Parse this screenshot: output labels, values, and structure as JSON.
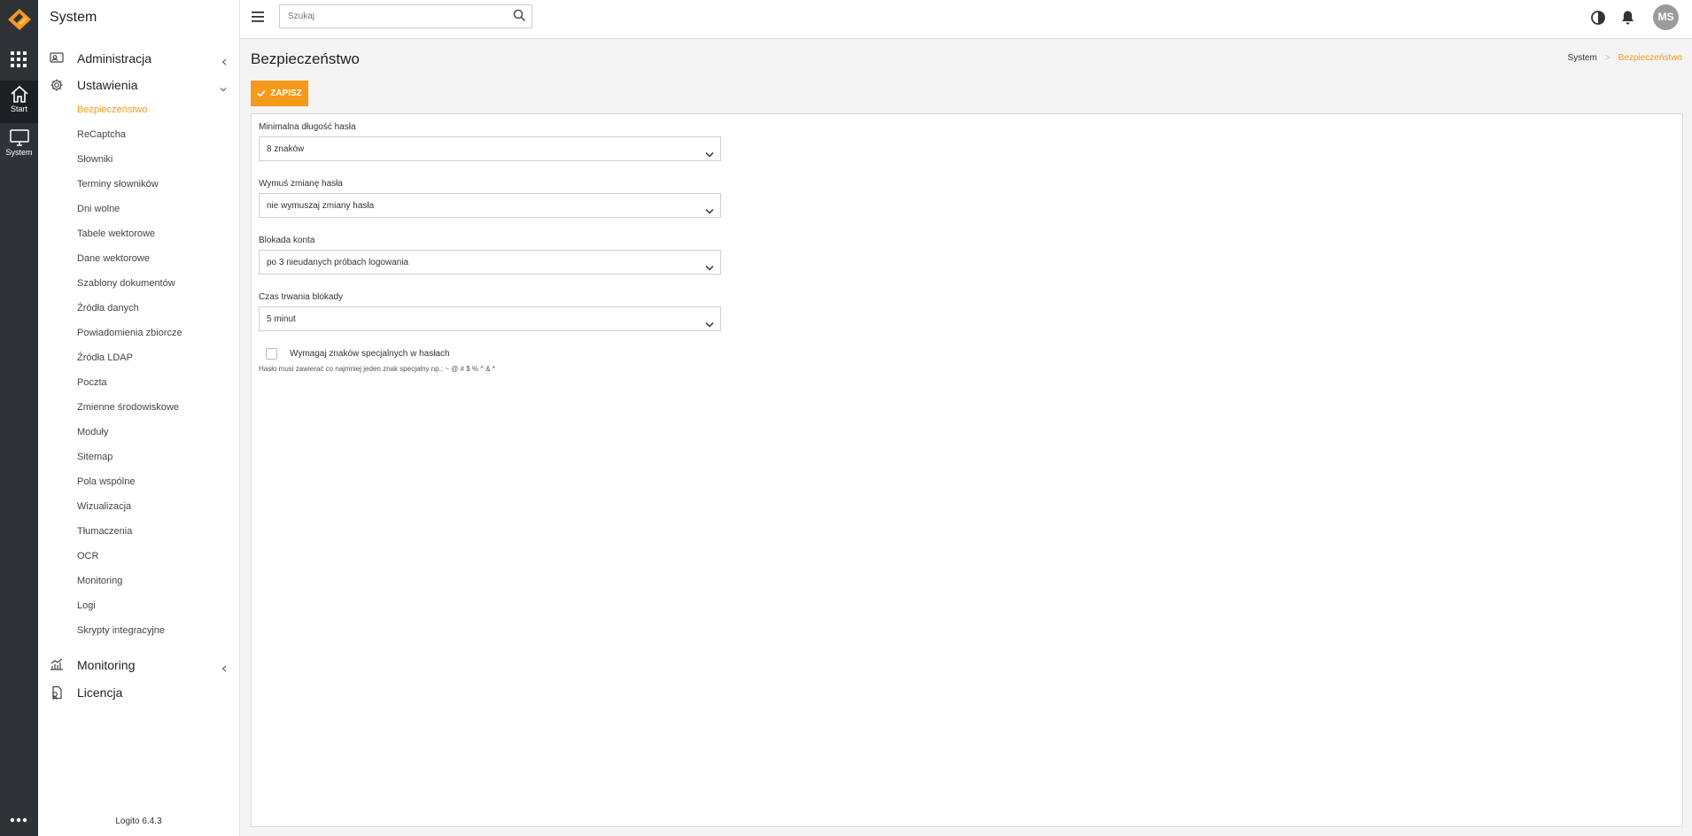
{
  "app": {
    "section_title": "System",
    "version": "Logito 6.4.3"
  },
  "rail": {
    "items": [
      {
        "label": "Start",
        "icon": "home-icon"
      },
      {
        "label": "System",
        "icon": "monitor-icon"
      }
    ]
  },
  "sidebar": {
    "sections": [
      {
        "label": "Administracja",
        "icon": "admin-id-card-icon",
        "expanded": false
      },
      {
        "label": "Ustawienia",
        "icon": "gear-icon",
        "expanded": true
      },
      {
        "label": "Monitoring",
        "icon": "chart-icon",
        "expanded": false
      },
      {
        "label": "Licencja",
        "icon": "license-icon",
        "expanded": false
      }
    ],
    "settings_items": [
      "Bezpieczeństwo",
      "ReCaptcha",
      "Słowniki",
      "Terminy słowników",
      "Dni wolne",
      "Tabele wektorowe",
      "Dane wektorowe",
      "Szablony dokumentów",
      "Źródła danych",
      "Powiadomienia zbiorcze",
      "Źródła LDAP",
      "Poczta",
      "Zmienne środowiskowe",
      "Moduły",
      "Sitemap",
      "Pola wspólne",
      "Wizualizacja",
      "Tłumaczenia",
      "OCR",
      "Monitoring",
      "Logi",
      "Skrypty integracyjne"
    ],
    "active_item": "Bezpieczeństwo"
  },
  "topbar": {
    "search_placeholder": "Szukaj",
    "avatar_initials": "MS"
  },
  "page": {
    "title": "Bezpieczeństwo",
    "breadcrumb": [
      "System",
      "Bezpieczeństwo"
    ],
    "save_label": "ZAPISZ"
  },
  "form": {
    "fields": [
      {
        "label": "Minimalna długość hasła",
        "value": "8 znaków"
      },
      {
        "label": "Wymuś zmianę hasła",
        "value": "nie wymuszaj zmiany hasła"
      },
      {
        "label": "Blokada konta",
        "value": "po 3 nieudanych próbach logowania"
      },
      {
        "label": "Czas trwania blokady",
        "value": "5 minut"
      }
    ],
    "special_chars_checkbox": {
      "label": "Wymagaj znaków specjalnych w hasłach",
      "checked": false,
      "hint": "Hasło musi zawierać co najmniej jeden znak specjalny np.: ~ @ # $ % ^ & *"
    }
  },
  "colors": {
    "accent": "#f59a1a",
    "rail_bg": "#2f3337"
  }
}
